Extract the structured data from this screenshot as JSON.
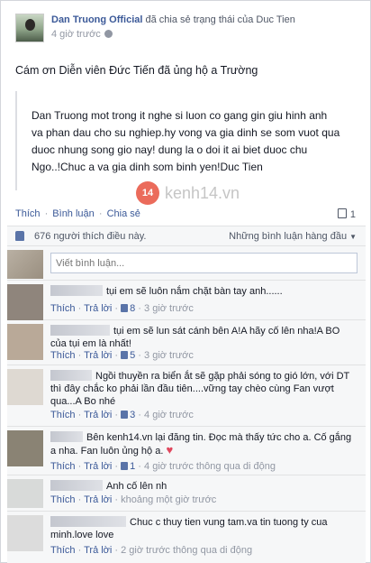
{
  "post": {
    "author": "Dan Truong Official",
    "action": " đã chia sẻ trạng thái của Duc Tien",
    "time": "4 giờ trước",
    "status": "Cám ơn Diễn viên Đức Tiến đã ủng hộ a Trường",
    "quote_lines": [
      "Dan Truong mot trong it nghe si luon co gang gin giu hinh anh",
      "va phan dau cho su nghiep.hy vong va gia dinh se som vuot qua",
      "duoc nhung song gio nay! dung la o doi it ai biet duoc chu",
      "Ngo..!Chuc a va gia dinh som binh yen!Duc Tien"
    ],
    "watermark_badge": "14",
    "watermark_text": "kenh14.vn"
  },
  "actions": {
    "like": "Thích",
    "comment": "Bình luận",
    "share": "Chia sẻ",
    "comment_count": "1"
  },
  "ufi": {
    "likes_text": "676 người thích điều này.",
    "sort_label": "Những bình luận hàng đầu",
    "comment_placeholder": "Viết bình luận..."
  },
  "comments": [
    {
      "text": "tụi em sẽ luôn nắm chặt bàn tay anh......",
      "like": "Thích",
      "reply": "Trả lời",
      "likes": "8",
      "time": "3 giờ trước",
      "extra": "",
      "avatar_color": "#8f857c"
    },
    {
      "text": "tụi em sẽ lun sát cánh bên A!A hãy cố lên nha!A BO của tụi em là nhất!",
      "like": "Thích",
      "reply": "Trả lời",
      "likes": "5",
      "time": "3 giờ trước",
      "extra": "",
      "avatar_color": "#b9a998"
    },
    {
      "text": "Ngồi thuyền ra biển ắt sẽ gặp phải sóng to gió lớn, với DT thì đây chắc ko phải lần đầu tiên....vững tay chèo cùng Fan vượt qua...A Bo nhé",
      "like": "Thích",
      "reply": "Trả lời",
      "likes": "3",
      "time": "4 giờ trước",
      "extra": "",
      "avatar_color": "#ded9d2"
    },
    {
      "text": "Bên kenh14.vn lại đăng tin. Đọc mà thấy tức cho a. Cố gắng a nha. Fan luôn ủng hộ a.",
      "like": "Thích",
      "reply": "Trả lời",
      "likes": "1",
      "time": "4 giờ trước",
      "extra": "thông qua di động",
      "avatar_color": "#8a8374"
    },
    {
      "text": "Anh cố lên nh",
      "like": "Thích",
      "reply": "Trả lời",
      "likes": "",
      "time": "khoảng một giờ trước",
      "extra": "",
      "avatar_color": "#d8dad9"
    },
    {
      "text": "Chuc c thuy tien vung tam.va tin tuong ty cua minh.love love",
      "like": "Thích",
      "reply": "Trả lời",
      "likes": "",
      "time": "2 giờ trước",
      "extra": "thông qua di động",
      "avatar_color": "#dcdcdc"
    }
  ]
}
